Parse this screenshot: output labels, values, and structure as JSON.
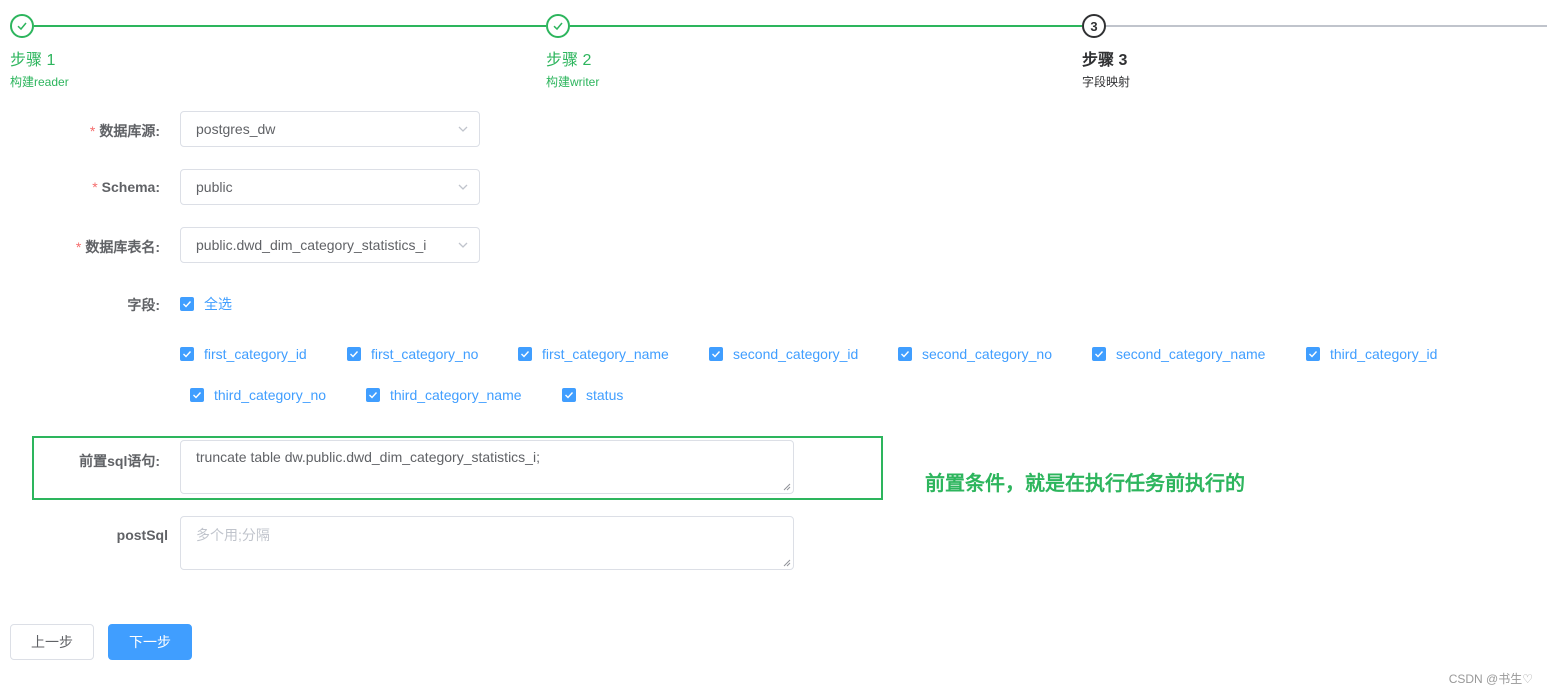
{
  "steps": [
    {
      "title": "步骤 1",
      "desc": "构建reader",
      "status": "done"
    },
    {
      "title": "步骤 2",
      "desc": "构建writer",
      "status": "done"
    },
    {
      "title": "步骤 3",
      "desc": "字段映射",
      "status": "active",
      "number": "3"
    }
  ],
  "form": {
    "datasource": {
      "label": "数据库源:",
      "value": "postgres_dw"
    },
    "schema": {
      "label": "Schema:",
      "value": "public"
    },
    "table": {
      "label": "数据库表名:",
      "value": "public.dwd_dim_category_statistics_i"
    },
    "fields": {
      "label": "字段:",
      "select_all": "全选",
      "items": [
        "first_category_id",
        "first_category_no",
        "first_category_name",
        "second_category_id",
        "second_category_no",
        "second_category_name",
        "third_category_id",
        "third_category_no",
        "third_category_name",
        "status"
      ]
    },
    "pre_sql": {
      "label": "前置sql语句:",
      "value": "truncate table dw.public.dwd_dim_category_statistics_i;"
    },
    "post_sql": {
      "label": "postSql",
      "placeholder": "多个用;分隔"
    }
  },
  "annotation": "前置条件，就是在执行任务前执行的",
  "buttons": {
    "prev": "上一步",
    "next": "下一步"
  },
  "watermark": "CSDN @书生♡",
  "colors": {
    "success": "#2db55d",
    "primary": "#409eff",
    "required": "#f56c6c"
  }
}
